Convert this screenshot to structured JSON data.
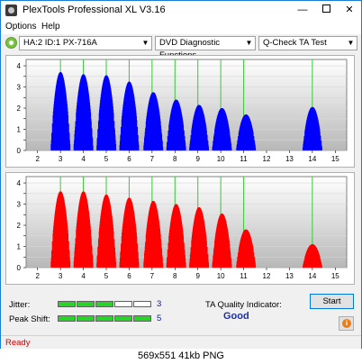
{
  "window": {
    "title": "PlexTools Professional XL V3.16",
    "minimize_glyph": "—",
    "close_glyph": "✕"
  },
  "menu": {
    "items": [
      {
        "label": "Options"
      },
      {
        "label": "Help"
      }
    ]
  },
  "toolbar": {
    "drive": "HA:2 ID:1  PX-716A",
    "function": "DVD Diagnostic Functions",
    "test": "Q-Check TA Test"
  },
  "colors": {
    "top_chart_fill": "#0000ff",
    "bottom_chart_fill": "#ff0000",
    "grid_line": "#33cc33",
    "plot_bg_top": "#ffffff",
    "plot_bg_bottom": "#b8b8b8"
  },
  "chart_data": [
    {
      "type": "area",
      "x_ticks": [
        2,
        3,
        4,
        5,
        6,
        7,
        8,
        9,
        10,
        11,
        12,
        13,
        14,
        15
      ],
      "y_ticks": [
        0,
        0.5,
        1,
        1.5,
        2,
        2.5,
        3,
        3.5,
        4
      ],
      "y_tick_labels": [
        "0",
        "",
        "1",
        "",
        "2",
        "",
        "3",
        "",
        "4"
      ],
      "xlim": [
        1.5,
        15.5
      ],
      "ylim": [
        0,
        4.3
      ],
      "grid_x": [
        3,
        4,
        5,
        6,
        7,
        8,
        9,
        10,
        11,
        14
      ],
      "peaks": [
        {
          "center": 3.0,
          "height": 3.7
        },
        {
          "center": 4.0,
          "height": 3.6
        },
        {
          "center": 5.0,
          "height": 3.55
        },
        {
          "center": 6.0,
          "height": 3.25
        },
        {
          "center": 7.05,
          "height": 2.75
        },
        {
          "center": 8.05,
          "height": 2.4
        },
        {
          "center": 9.05,
          "height": 2.15
        },
        {
          "center": 10.05,
          "height": 2.0
        },
        {
          "center": 11.1,
          "height": 1.7
        },
        {
          "center": 14.0,
          "height": 2.05
        }
      ]
    },
    {
      "type": "area",
      "x_ticks": [
        2,
        3,
        4,
        5,
        6,
        7,
        8,
        9,
        10,
        11,
        12,
        13,
        14,
        15
      ],
      "y_ticks": [
        0,
        0.5,
        1,
        1.5,
        2,
        2.5,
        3,
        3.5,
        4
      ],
      "y_tick_labels": [
        "0",
        "",
        "1",
        "",
        "2",
        "",
        "3",
        "",
        "4"
      ],
      "xlim": [
        1.5,
        15.5
      ],
      "ylim": [
        0,
        4.3
      ],
      "grid_x": [
        3,
        4,
        5,
        6,
        7,
        8,
        9,
        10,
        11,
        14
      ],
      "peaks": [
        {
          "center": 3.0,
          "height": 3.6
        },
        {
          "center": 4.0,
          "height": 3.6
        },
        {
          "center": 5.0,
          "height": 3.45
        },
        {
          "center": 6.0,
          "height": 3.3
        },
        {
          "center": 7.05,
          "height": 3.15
        },
        {
          "center": 8.05,
          "height": 3.0
        },
        {
          "center": 9.05,
          "height": 2.85
        },
        {
          "center": 10.05,
          "height": 2.55
        },
        {
          "center": 11.1,
          "height": 1.8
        },
        {
          "center": 14.0,
          "height": 1.1
        }
      ]
    }
  ],
  "metrics": {
    "jitter_label": "Jitter:",
    "jitter_level": 3,
    "jitter_value": "3",
    "peak_shift_label": "Peak Shift:",
    "peak_shift_level": 5,
    "peak_shift_value": "5",
    "segments_total": 5
  },
  "ta_quality": {
    "label": "TA Quality Indicator:",
    "value": "Good"
  },
  "buttons": {
    "start": "Start",
    "info": "i"
  },
  "status": {
    "text": "Ready"
  },
  "caption": "569x551  41kb  PNG"
}
